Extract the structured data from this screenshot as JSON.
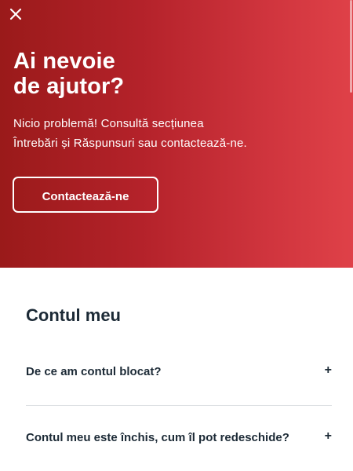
{
  "hero": {
    "close_icon": "close-icon",
    "title_line1": "Ai nevoie",
    "title_line2": "de ajutor?",
    "description_line1": "Nicio problemă! Consultă secțiunea",
    "description_line2": "Întrebări și Răspunsuri sau contactează-ne.",
    "contact_button": "Contactează-ne",
    "gradient_start": "#9a1a1a",
    "gradient_end": "#df4148"
  },
  "faq": {
    "section_title": "Contul meu",
    "items": [
      {
        "question": "De ce am contul blocat?",
        "toggle": "+"
      },
      {
        "question": "Contul meu este închis, cum îl pot redeschide?",
        "toggle": "+"
      }
    ]
  }
}
